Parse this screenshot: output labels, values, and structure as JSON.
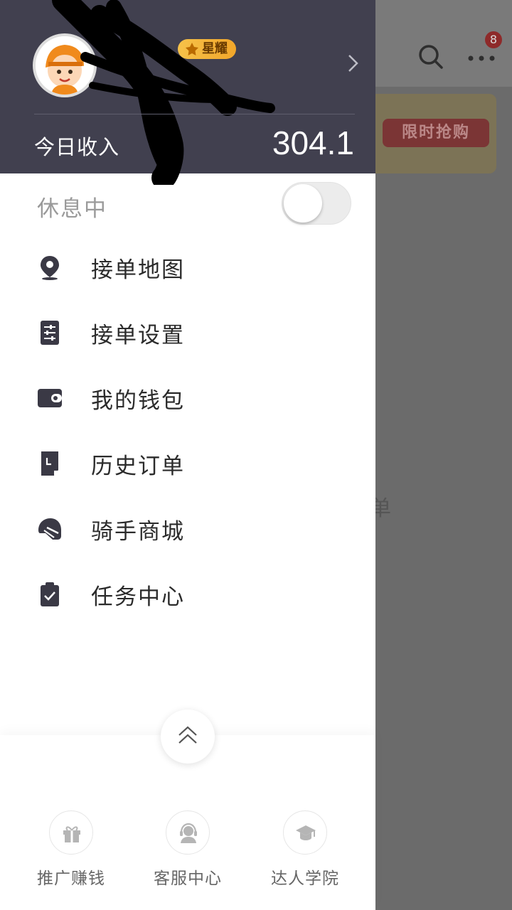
{
  "header": {
    "level_badge": "星耀",
    "income_label": "今日收入",
    "income_value": "304.1"
  },
  "status": {
    "rest_label": "休息中",
    "toggle_on": false
  },
  "menu": [
    {
      "label": "接单地图",
      "icon": "location-pin-icon"
    },
    {
      "label": "接单设置",
      "icon": "settings-list-icon"
    },
    {
      "label": "我的钱包",
      "icon": "wallet-icon"
    },
    {
      "label": "历史订单",
      "icon": "order-history-icon"
    },
    {
      "label": "骑手商城",
      "icon": "helmet-icon"
    },
    {
      "label": "任务中心",
      "icon": "task-clipboard-icon"
    }
  ],
  "bottom": [
    {
      "label": "推广赚钱",
      "icon": "gift-icon"
    },
    {
      "label": "客服中心",
      "icon": "customer-service-icon"
    },
    {
      "label": "达人学院",
      "icon": "graduation-cap-icon"
    }
  ],
  "background": {
    "notification_count": "8",
    "promo_button": "限时抢购",
    "partial_text": "单"
  }
}
